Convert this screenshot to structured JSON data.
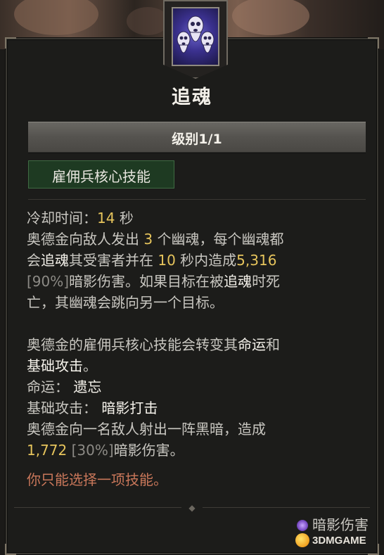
{
  "skill": {
    "icon": "ghost-skulls-icon",
    "title": "追魂",
    "rank_label": "级别1/1",
    "tag": "雇佣兵核心技能"
  },
  "description": {
    "cooldown_label": "冷却时间：",
    "cooldown_value": "14",
    "cooldown_unit": "秒",
    "l2a": "奥德金向敌人发出",
    "l2b": "3",
    "l2c": "个幽魂，每个幽魂都",
    "l3a": "会",
    "l3b": "追魂",
    "l3c": "其受害者并在",
    "l3d": "10",
    "l3e": "秒内造成",
    "l3f": "5,316",
    "l4a": "[90%]",
    "l4b": "暗影伤害。如果目标在被",
    "l4c": "追魂",
    "l4d": "时死",
    "l5": "亡，其幽魂会跳向另一个目标。",
    "l7a": "奥德金的雇佣兵核心技能会转变其",
    "l7b": "命运",
    "l7c": "和",
    "l8a": "基础攻击",
    "l8b": "。",
    "fate_label": "命运：",
    "fate_value": "遗忘",
    "basic_label": "基础攻击：",
    "basic_value": "暗影打击",
    "l11": "奥德金向一名敌人射出一阵黑暗，造成",
    "l12a": "1,772",
    "l12b": "[30%]",
    "l12c": "暗影伤害。",
    "warning": "你只能选择一项技能。"
  },
  "damage_type": {
    "icon": "shadow-damage-icon",
    "label": "暗影伤害"
  },
  "watermark": {
    "text": "3DMGAME"
  },
  "colors": {
    "number": "#e6c45c",
    "highlight": "#f6f3ec",
    "warning": "#c9775a",
    "tag_bg": "#1e3a22"
  }
}
